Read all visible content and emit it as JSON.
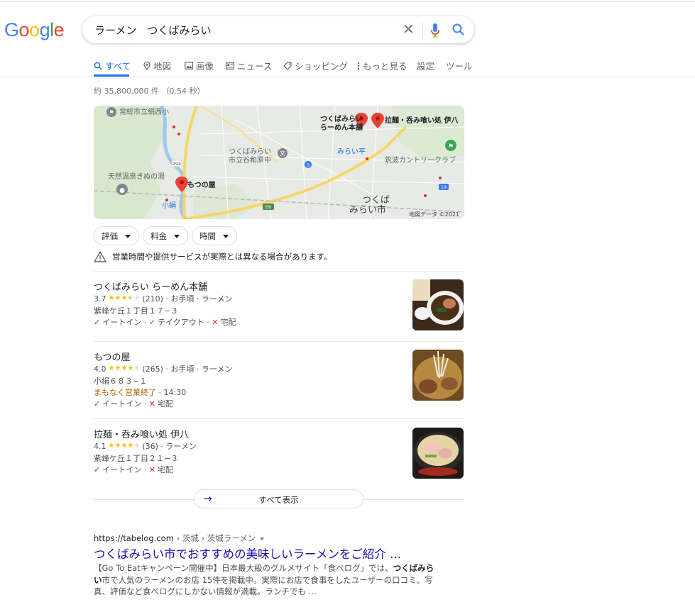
{
  "logo": "Google",
  "search": {
    "query": "ラーメン　つくばみらい"
  },
  "tabs": [
    {
      "label": "すべて",
      "icon": "search-icon",
      "active": true
    },
    {
      "label": "地図",
      "icon": "map-pin-icon"
    },
    {
      "label": "画像",
      "icon": "image-icon"
    },
    {
      "label": "ニュース",
      "icon": "news-icon"
    },
    {
      "label": "ショッピング",
      "icon": "tag-icon"
    },
    {
      "label": "もっと見る",
      "icon": "more-vert-icon"
    },
    {
      "label": "設定"
    },
    {
      "label": "ツール"
    }
  ],
  "result_stats": "約 35,800,000 件 （0.54 秒）",
  "map": {
    "labels": {
      "school": "常総市立絹西小",
      "shop1_line1": "つくばみらい",
      "shop1_line2": "らーめん本舗",
      "shop3": "拉麺・呑み喰い処 伊八",
      "station1": "みらい平",
      "school2_line1": "つくばみらい",
      "school2_line2": "市立谷和原中",
      "golf": "筑波カントリークラブ",
      "onsen": "天然温泉きぬの湯",
      "shop2": "もつの屋",
      "station2": "小絹",
      "city_line1": "つくば",
      "city_line2": "みらい市",
      "route294": "294",
      "route3": "3",
      "route19": "19",
      "routeE6": "E6",
      "credit": "地図データ ©2021"
    }
  },
  "filters": [
    {
      "label": "評価"
    },
    {
      "label": "料金"
    },
    {
      "label": "時間"
    }
  ],
  "warning": "営業時間や提供サービスが実際とは異なる場合があります。",
  "listings": [
    {
      "name": "つくばみらい らーめん本舗",
      "rating": "3.7",
      "rating_value": 3.7,
      "reviews": "(210)",
      "meta": "· お手頃 · ラーメン",
      "address": "紫峰ケ丘１丁目１７−３",
      "service1": "イートイン",
      "service2": "テイクアウト",
      "service3": "宅配"
    },
    {
      "name": "もつの屋",
      "rating": "4.0",
      "rating_value": 4.0,
      "reviews": "(265)",
      "meta": "· お手頃 · ラーメン",
      "address": "小絹６８３−１",
      "hours_status": "まもなく営業終了",
      "hours_time": "· 14:30",
      "service1": "イートイン",
      "service3": "宅配"
    },
    {
      "name": "拉麺・呑み喰い処 伊八",
      "rating": "4.1",
      "rating_value": 4.1,
      "reviews": "(36)",
      "meta": "· ラーメン",
      "address": "紫峰ケ丘１丁目２１−３",
      "service1": "イートイン",
      "service3": "宅配"
    }
  ],
  "show_all": "すべて表示",
  "organic": {
    "site": "https://tabelog.com",
    "path": " › 茨城 › 茨城ラーメン",
    "title": "つくばみらい市でおすすめの美味しいラーメンをご紹介 ...",
    "snippet_1": "【Go To Eatキャンペーン開催中】日本最大級のグルメサイト「食べログ」では、",
    "snippet_bold_1": "つくばみらい",
    "snippet_2": "市で人気のラーメンのお店 15件を掲載中。実際にお店で食事をしたユーザーの口コミ、写真、評価など食べログにしかない情報が満載。ランチでも ..."
  },
  "colors": {
    "accent": "#1a73e8",
    "link": "#1a0dab",
    "star": "#fbbc04",
    "check": "#188038",
    "cross": "#d93025",
    "closing": "#b06000"
  }
}
